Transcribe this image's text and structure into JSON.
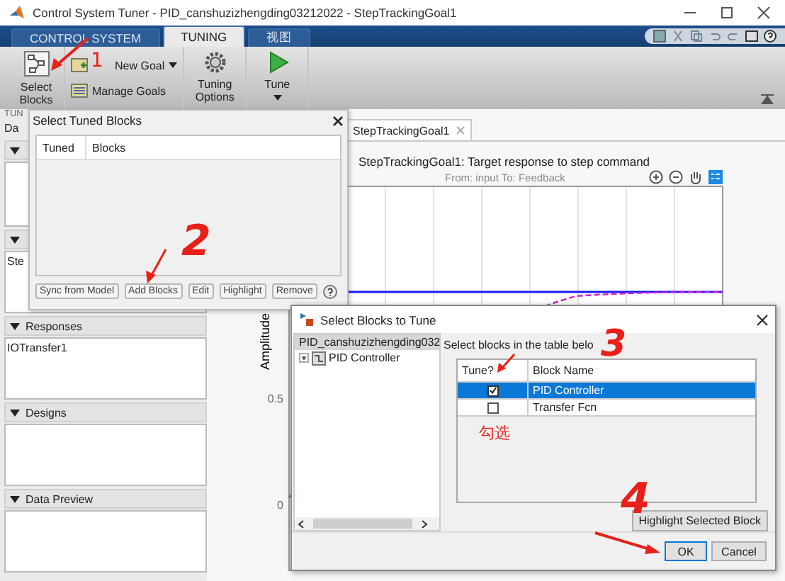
{
  "window": {
    "title": "Control System Tuner - PID_canshuzizhengding03212022 - StepTrackingGoal1"
  },
  "ribbon_tabs": [
    {
      "label": "CONTROL SYSTEM",
      "selected": false
    },
    {
      "label": "TUNING",
      "selected": true
    },
    {
      "label": "视图",
      "selected": false
    }
  ],
  "toolstrip": {
    "select_blocks": "Select Blocks",
    "new_goal": "New Goal",
    "manage_goals": "Manage Goals",
    "tuning_options": "Tuning Options",
    "tune": "Tune",
    "section_label": "TUN"
  },
  "data_browser": {
    "tab": "Da",
    "covered_item": "Ste",
    "sections": [
      {
        "title": "Responses",
        "items": [
          "IOTransfer1"
        ]
      },
      {
        "title": "Designs"
      },
      {
        "title": "Data Preview"
      }
    ]
  },
  "tuned_blocks_window": {
    "title": "Select Tuned Blocks",
    "columns": [
      "Tuned",
      "Blocks"
    ],
    "buttons": [
      "Sync from Model",
      "Add Blocks",
      "Edit",
      "Highlight",
      "Remove"
    ]
  },
  "plot": {
    "tab": "StepTrackingGoal1",
    "title": "StepTrackingGoal1: Target response to step command",
    "subtitle": "From: input  To: Feedback",
    "ylabel": "Amplitude",
    "ytick_labels": [
      "0.5",
      "0"
    ]
  },
  "dialog": {
    "title": "Select Blocks to Tune",
    "tree": [
      {
        "label": "PID_canshuzizhengding032",
        "selected": true,
        "children": [
          {
            "label": "PID Controller",
            "selected": false,
            "expanded": false
          }
        ]
      }
    ],
    "instruction": "Select blocks in the table belo",
    "columns": [
      "Tune?",
      "Block Name"
    ],
    "rows": [
      {
        "name": "PID Controller",
        "checked": true,
        "selected": true
      },
      {
        "name": "Transfer Fcn",
        "checked": false,
        "selected": false
      }
    ],
    "highlight_button": "Highlight Selected Block",
    "buttons": [
      "OK",
      "Cancel"
    ]
  },
  "annotations": {
    "step_1": "1",
    "step_2": "2",
    "step_3": "3",
    "step_4": "4",
    "check_note": "勾选"
  }
}
